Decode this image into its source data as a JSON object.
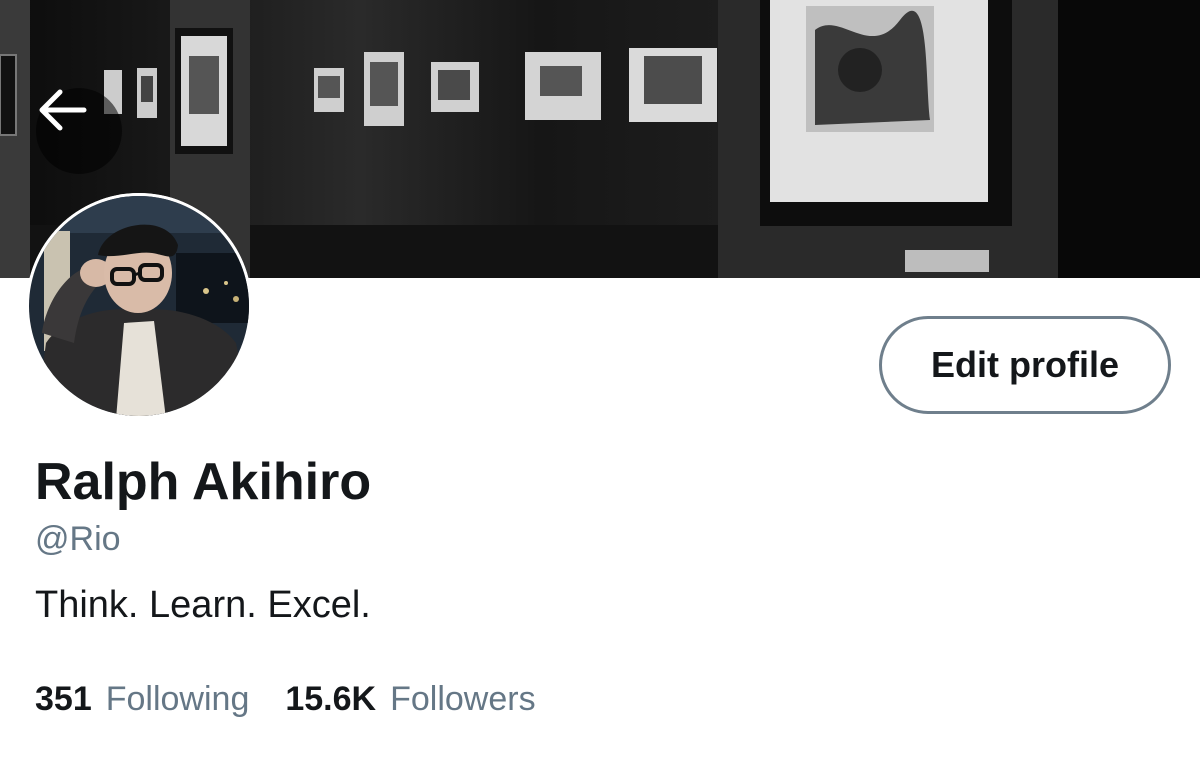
{
  "header": {
    "back_icon": "arrow-left-icon",
    "banner_image": "black-and-white photo of a gallery wall with framed artworks"
  },
  "profile": {
    "avatar": "profile photo of a person with glasses",
    "edit_label": "Edit profile",
    "name": "Ralph Akihiro",
    "handle": "@Rio",
    "bio": "Think. Learn. Excel."
  },
  "stats": {
    "following_count": "351",
    "following_label": "Following",
    "followers_count": "15.6K",
    "followers_label": "Followers"
  },
  "colors": {
    "primary_text": "#14171a",
    "secondary_text": "#657786",
    "button_border": "#6f7f8c",
    "background": "#ffffff"
  }
}
